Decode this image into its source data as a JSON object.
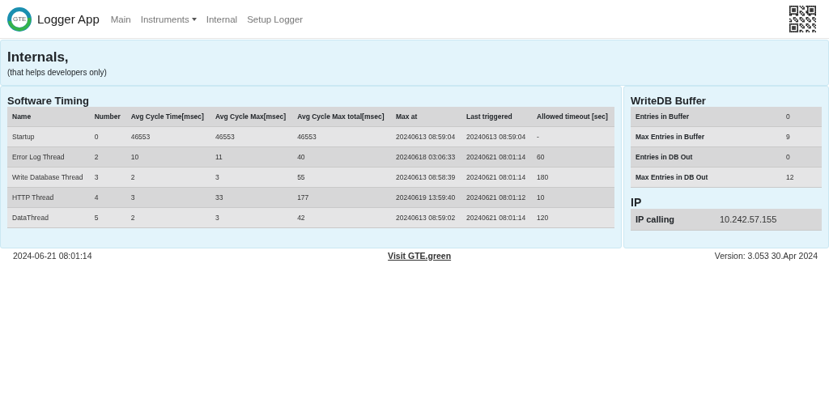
{
  "navbar": {
    "logo_text": "GTE",
    "brand": "Logger App",
    "links": [
      {
        "label": "Main",
        "dropdown": false
      },
      {
        "label": "Instruments",
        "dropdown": true
      },
      {
        "label": "Internal",
        "dropdown": false
      },
      {
        "label": "Setup Logger",
        "dropdown": false
      }
    ]
  },
  "header": {
    "title": "Internals,",
    "subtitle": "(that helps developers only)"
  },
  "software_timing": {
    "title": "Software Timing",
    "columns": [
      "Name",
      "Number",
      "Avg Cycle Time[msec]",
      "Avg Cycle Max[msec]",
      "Avg Cycle Max total[msec]",
      "Max at",
      "Last triggered",
      "Allowed timeout [sec]"
    ],
    "rows": [
      [
        "Startup",
        "0",
        "46553",
        "46553",
        "46553",
        "20240613 08:59:04",
        "20240613 08:59:04",
        "-"
      ],
      [
        "Error Log Thread",
        "2",
        "10",
        "11",
        "40",
        "20240618 03:06:33",
        "20240621 08:01:14",
        "60"
      ],
      [
        "Write Database Thread",
        "3",
        "2",
        "3",
        "55",
        "20240613 08:58:39",
        "20240621 08:01:14",
        "180"
      ],
      [
        "HTTP Thread",
        "4",
        "3",
        "33",
        "177",
        "20240619 13:59:40",
        "20240621 08:01:12",
        "10"
      ],
      [
        "DataThread",
        "5",
        "2",
        "3",
        "42",
        "20240613 08:59:02",
        "20240621 08:01:14",
        "120"
      ]
    ]
  },
  "writedb_buffer": {
    "title": "WriteDB Buffer",
    "rows": [
      [
        "Entries in Buffer",
        "0"
      ],
      [
        "Max Entries in Buffer",
        "9"
      ],
      [
        "Entries in DB Out",
        "0"
      ],
      [
        "Max Entries in DB Out",
        "12"
      ]
    ]
  },
  "ip": {
    "title": "IP",
    "rows": [
      [
        "IP calling",
        "10.242.57.155"
      ]
    ]
  },
  "footer": {
    "timestamp": "2024-06-21 08:01:14",
    "link": "Visit GTE.green",
    "version": "Version: 3.053 30.Apr 2024"
  }
}
